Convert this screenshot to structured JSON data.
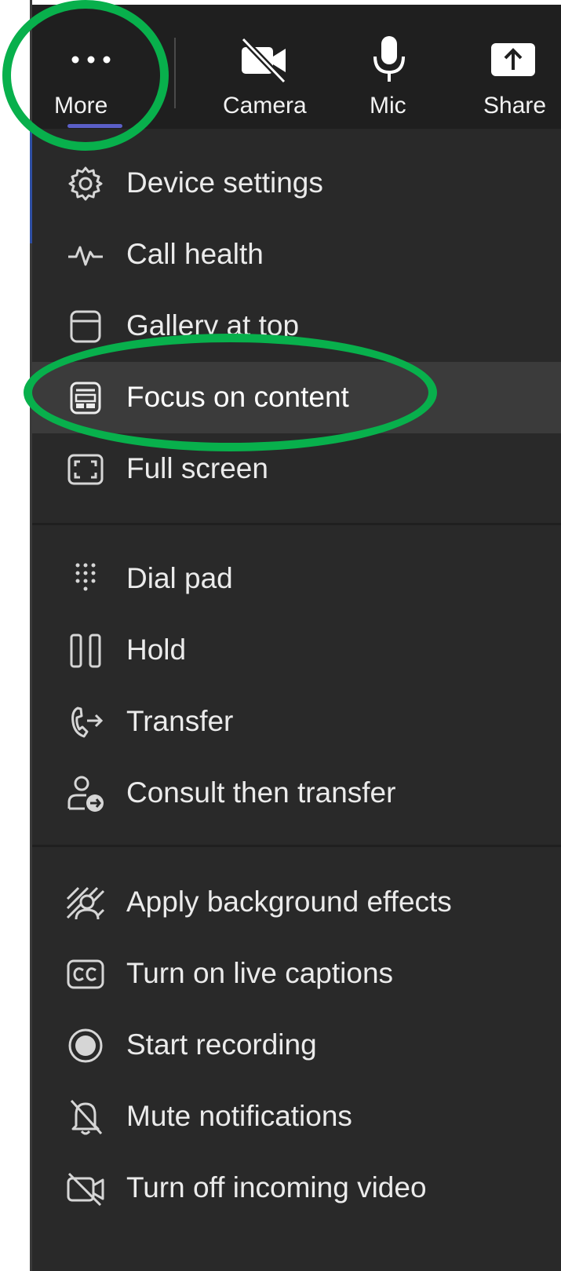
{
  "toolbar": {
    "more_label": "More",
    "camera_label": "Camera",
    "mic_label": "Mic",
    "share_label": "Share"
  },
  "menu": {
    "items": [
      {
        "label": "Device settings",
        "icon": "gear-icon"
      },
      {
        "label": "Call health",
        "icon": "pulse-icon"
      },
      {
        "label": "Gallery at top",
        "icon": "gallery-top-icon"
      },
      {
        "label": "Focus on content",
        "icon": "focus-content-icon"
      },
      {
        "label": "Full screen",
        "icon": "fullscreen-icon"
      },
      {
        "label": "Dial pad",
        "icon": "dialpad-icon"
      },
      {
        "label": "Hold",
        "icon": "hold-icon"
      },
      {
        "label": "Transfer",
        "icon": "transfer-icon"
      },
      {
        "label": "Consult then transfer",
        "icon": "consult-transfer-icon"
      },
      {
        "label": "Apply background effects",
        "icon": "background-effects-icon"
      },
      {
        "label": "Turn on live captions",
        "icon": "captions-icon"
      },
      {
        "label": "Start recording",
        "icon": "record-icon"
      },
      {
        "label": "Mute notifications",
        "icon": "bell-off-icon"
      },
      {
        "label": "Turn off incoming video",
        "icon": "video-off-icon"
      }
    ]
  },
  "colors": {
    "toolbar_bg": "#1f1f1f",
    "menu_bg": "#292929",
    "active_item_bg": "#3b3b3b",
    "highlight_ring": "#08b04c",
    "accent": "#5b5fc7"
  }
}
